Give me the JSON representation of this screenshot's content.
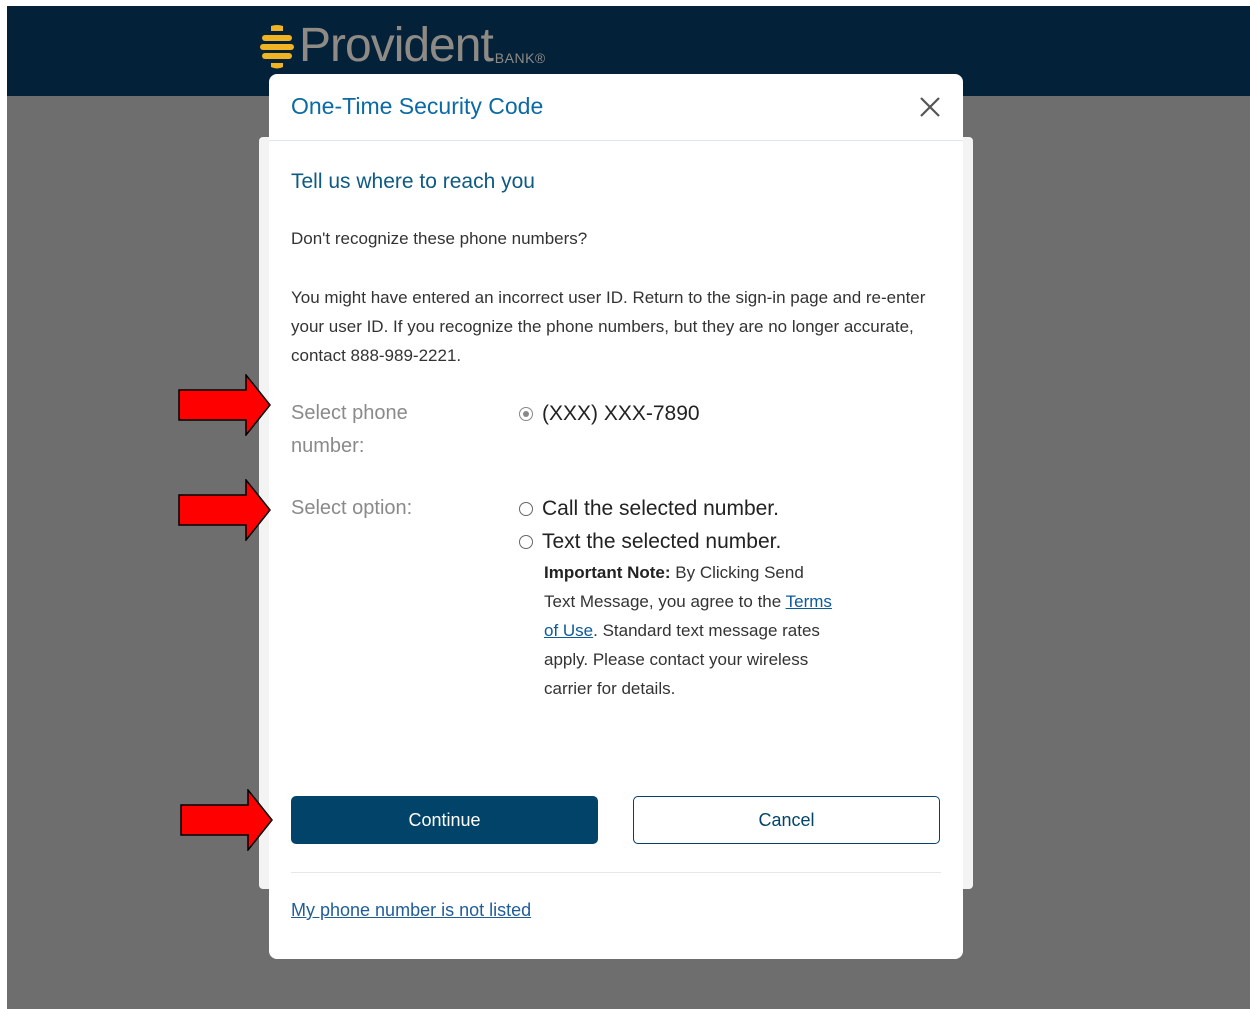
{
  "brand": {
    "name": "Provident",
    "suffix": "BANK®",
    "colors": {
      "navy": "#03223a",
      "gold": "#f0b323",
      "logo_text": "#8f8a84"
    }
  },
  "modal": {
    "title": "One-Time Security Code",
    "close_icon": "close-icon",
    "subtitle": "Tell us where to reach you",
    "question": "Don't recognize these phone numbers?",
    "help_text": "You might have entered an incorrect user ID. Return to the sign-in page and re-enter your user ID. If you recognize the phone numbers, but they are no longer accurate, contact 888-989-2221.",
    "phone_label": "Select phone number:",
    "phone_option": "(XXX) XXX-7890",
    "option_label": "Select option:",
    "options": [
      {
        "label": "Call the selected number.",
        "selected": false
      },
      {
        "label": "Text the selected number.",
        "selected": false
      }
    ],
    "note": {
      "bold": "Important Note:",
      "before_link": " By Clicking Send Text Message, you agree to the ",
      "link": "Terms of Use",
      "after_link": ". Standard text message rates apply. Please contact your wireless carrier for details."
    },
    "continue_label": "Continue",
    "cancel_label": "Cancel",
    "not_listed_link": "My phone number is not listed"
  },
  "annotations": {
    "arrow_color": "#ff0000",
    "arrow_count": 3
  }
}
